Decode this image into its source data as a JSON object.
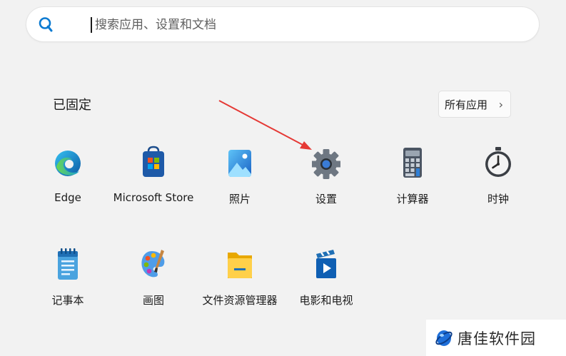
{
  "search": {
    "placeholder": "搜索应用、设置和文档",
    "value": ""
  },
  "pinned": {
    "title": "已固定",
    "all_apps_label": "所有应用",
    "all_apps_chevron": "›"
  },
  "apps": [
    {
      "label": "Edge",
      "icon": "edge-icon"
    },
    {
      "label": "Microsoft Store",
      "icon": "store-icon"
    },
    {
      "label": "照片",
      "icon": "photos-icon"
    },
    {
      "label": "设置",
      "icon": "settings-gear-icon"
    },
    {
      "label": "计算器",
      "icon": "calculator-icon"
    },
    {
      "label": "时钟",
      "icon": "clock-icon"
    },
    {
      "label": "记事本",
      "icon": "notepad-icon"
    },
    {
      "label": "画图",
      "icon": "paint-icon"
    },
    {
      "label": "文件资源管理器",
      "icon": "folder-icon"
    },
    {
      "label": "电影和电视",
      "icon": "movies-tv-icon"
    }
  ],
  "annotation": {
    "color": "#e53935",
    "points_to": "设置"
  },
  "watermark": {
    "text": "唐佳软件园"
  },
  "colors": {
    "accent": "#0078d4",
    "background": "#f2f2f2"
  }
}
